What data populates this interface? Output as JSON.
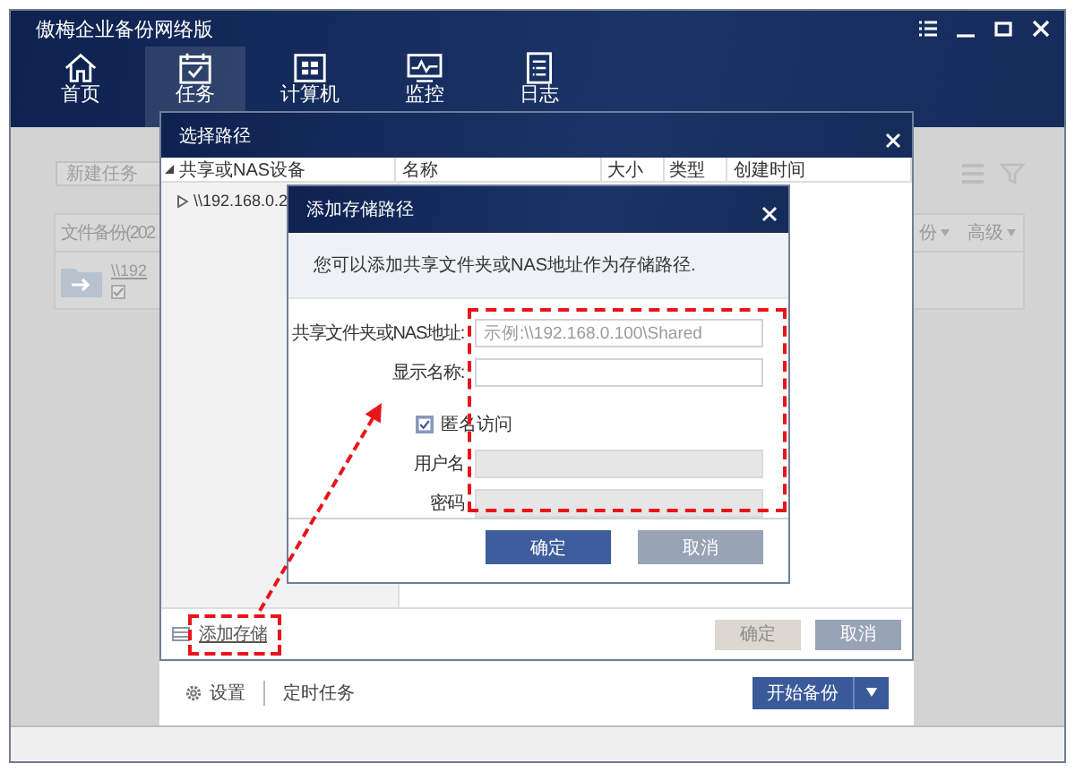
{
  "window": {
    "title": "傲梅企业备份网络版"
  },
  "nav_tabs": [
    {
      "label": "首页",
      "kind": "home",
      "selected": false
    },
    {
      "label": "任务",
      "kind": "tasks",
      "selected": true
    },
    {
      "label": "计算机",
      "kind": "computer",
      "selected": false
    },
    {
      "label": "监控",
      "kind": "monitor",
      "selected": false
    },
    {
      "label": "日志",
      "kind": "log",
      "selected": false
    }
  ],
  "background": {
    "new_task_field": {
      "placeholder": "新建任务"
    },
    "task_card": {
      "title": "文件备份(202",
      "path": "\\\\192",
      "checked": true,
      "menus": [
        "份",
        "高级"
      ]
    },
    "bottom_links": [
      "设置",
      "定时任务"
    ],
    "start_button": "开始备份"
  },
  "select_path_dialog": {
    "title": "选择路径",
    "tree": [
      {
        "label": "共享或NAS设备",
        "expanded": true,
        "children": [
          {
            "label": "\\\\192.168.0.2",
            "expanded": false
          }
        ]
      }
    ],
    "columns": [
      "名称",
      "大小",
      "类型",
      "创建时间"
    ],
    "add_storage_link": "添加存储",
    "buttons": [
      {
        "label": "确定",
        "disabled": true
      },
      {
        "label": "取消",
        "disabled": false
      }
    ]
  },
  "add_storage_dialog": {
    "title": "添加存储路径",
    "description": "您可以添加共享文件夹或NAS地址作为存储路径.",
    "fields": [
      {
        "kind": "text",
        "label": "共享文件夹或NAS地址:",
        "placeholder": "示例:\\\\192.168.0.100\\Shared",
        "disabled": false
      },
      {
        "kind": "text",
        "label": "显示名称:",
        "disabled": false
      },
      {
        "kind": "checkbox",
        "label": "匿名访问",
        "checked": true
      },
      {
        "kind": "text",
        "label": "用户名",
        "disabled": true
      },
      {
        "kind": "text",
        "label": "密码",
        "disabled": true
      }
    ],
    "buttons": [
      {
        "label": "确定",
        "primary": true
      },
      {
        "label": "取消",
        "primary": false
      }
    ]
  }
}
